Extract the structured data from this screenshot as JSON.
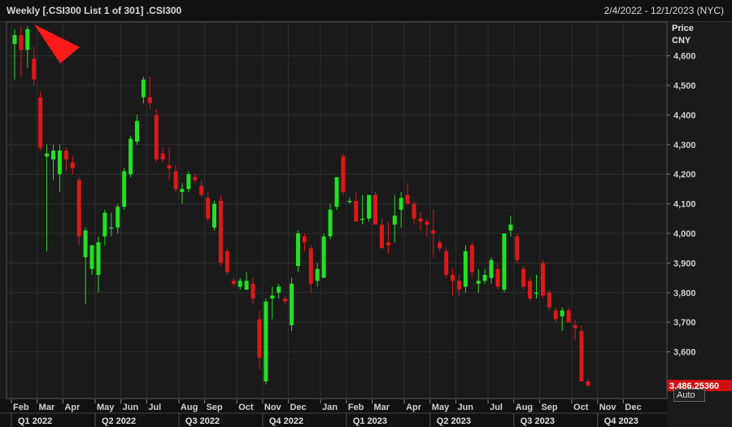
{
  "header": {
    "title": "Weekly [.CSI300 List 1 of 301] .CSI300",
    "date_range": "2/4/2022 - 12/1/2023 (NYC)"
  },
  "axis": {
    "price_label": "Price",
    "currency_label": "CNY",
    "auto_label": "Auto",
    "last_price": "3,486.25360"
  },
  "colors": {
    "up": "#22e022",
    "down": "#e01818",
    "background": "#1a1a1a",
    "grid": "#2e2e2e",
    "marker": "#ff1a1a"
  },
  "chart_data": {
    "type": "candlestick",
    "title": "Weekly [.CSI300 List 1 of 301] .CSI300",
    "ylabel": "Price CNY",
    "ylim": [
      3480,
      4760
    ],
    "yticks": [
      3600,
      3700,
      3800,
      3900,
      4000,
      4100,
      4200,
      4300,
      4400,
      4500,
      4600
    ],
    "ytick_labels": [
      "3,600",
      "3,700",
      "3,800",
      "3,900",
      "4,000",
      "4,100",
      "4,200",
      "4,300",
      "4,400",
      "4,500",
      "4,600"
    ],
    "grid": true,
    "months": [
      {
        "label": "Feb",
        "week": 0
      },
      {
        "label": "Mar",
        "week": 4
      },
      {
        "label": "Apr",
        "week": 8
      },
      {
        "label": "May",
        "week": 13
      },
      {
        "label": "Jun",
        "week": 17
      },
      {
        "label": "Jul",
        "week": 21
      },
      {
        "label": "Aug",
        "week": 26
      },
      {
        "label": "Sep",
        "week": 30
      },
      {
        "label": "Oct",
        "week": 35
      },
      {
        "label": "Nov",
        "week": 39
      },
      {
        "label": "Dec",
        "week": 43
      },
      {
        "label": "Jan",
        "week": 48
      },
      {
        "label": "Feb",
        "week": 52
      },
      {
        "label": "Mar",
        "week": 56
      },
      {
        "label": "Apr",
        "week": 61
      },
      {
        "label": "May",
        "week": 65
      },
      {
        "label": "Jun",
        "week": 69
      },
      {
        "label": "Jul",
        "week": 74
      },
      {
        "label": "Aug",
        "week": 78
      },
      {
        "label": "Sep",
        "week": 82
      },
      {
        "label": "Oct",
        "week": 87
      },
      {
        "label": "Nov",
        "week": 91
      },
      {
        "label": "Dec",
        "week": 95
      }
    ],
    "quarters": [
      {
        "label": "Q1 2022",
        "week": 0
      },
      {
        "label": "Q2 2022",
        "week": 13
      },
      {
        "label": "Q3 2022",
        "week": 26
      },
      {
        "label": "Q4 2022",
        "week": 39
      },
      {
        "label": "Q1 2023",
        "week": 52
      },
      {
        "label": "Q2 2023",
        "week": 65
      },
      {
        "label": "Q3 2023",
        "week": 78
      },
      {
        "label": "Q4 2023",
        "week": 91
      }
    ],
    "candles": [
      [
        4640,
        4690,
        4520,
        4670
      ],
      [
        4670,
        4700,
        4530,
        4620
      ],
      [
        4620,
        4700,
        4560,
        4690
      ],
      [
        4590,
        4630,
        4500,
        4520
      ],
      [
        4460,
        4480,
        4280,
        4290
      ],
      [
        4260,
        4300,
        3940,
        4270
      ],
      [
        4250,
        4300,
        4180,
        4280
      ],
      [
        4200,
        4300,
        4140,
        4280
      ],
      [
        4280,
        4290,
        4210,
        4250
      ],
      [
        4240,
        4260,
        4200,
        4220
      ],
      [
        4180,
        4190,
        3960,
        3990
      ],
      [
        3920,
        4020,
        3760,
        4010
      ],
      [
        3880,
        3960,
        3860,
        3960
      ],
      [
        3860,
        3990,
        3800,
        3970
      ],
      [
        3990,
        4080,
        3960,
        4070
      ],
      [
        4020,
        4070,
        3990,
        4020
      ],
      [
        4020,
        4100,
        4000,
        4090
      ],
      [
        4090,
        4220,
        4080,
        4210
      ],
      [
        4200,
        4330,
        4190,
        4320
      ],
      [
        4310,
        4400,
        4300,
        4380
      ],
      [
        4460,
        4530,
        4440,
        4520
      ],
      [
        4460,
        4530,
        4420,
        4440
      ],
      [
        4400,
        4420,
        4240,
        4250
      ],
      [
        4270,
        4290,
        4240,
        4250
      ],
      [
        4230,
        4290,
        4180,
        4220
      ],
      [
        4210,
        4230,
        4140,
        4150
      ],
      [
        4140,
        4170,
        4100,
        4150
      ],
      [
        4150,
        4210,
        4140,
        4200
      ],
      [
        4190,
        4200,
        4170,
        4180
      ],
      [
        4160,
        4180,
        4120,
        4130
      ],
      [
        4120,
        4140,
        4040,
        4050
      ],
      [
        4020,
        4110,
        4010,
        4100
      ],
      [
        4110,
        4130,
        3890,
        3900
      ],
      [
        3940,
        3950,
        3860,
        3870
      ],
      [
        3840,
        3850,
        3820,
        3830
      ],
      [
        3820,
        3850,
        3810,
        3840
      ],
      [
        3810,
        3870,
        3810,
        3840
      ],
      [
        3830,
        3850,
        3760,
        3780
      ],
      [
        3710,
        3740,
        3540,
        3580
      ],
      [
        3500,
        3780,
        3490,
        3770
      ],
      [
        3780,
        3820,
        3710,
        3790
      ],
      [
        3800,
        3830,
        3780,
        3820
      ],
      [
        3780,
        3790,
        3760,
        3770
      ],
      [
        3690,
        3850,
        3670,
        3830
      ],
      [
        3890,
        4010,
        3870,
        4000
      ],
      [
        3990,
        4000,
        3940,
        3970
      ],
      [
        3950,
        3960,
        3800,
        3830
      ],
      [
        3840,
        3900,
        3820,
        3880
      ],
      [
        3850,
        4000,
        3850,
        3990
      ],
      [
        3990,
        4100,
        3980,
        4080
      ],
      [
        4090,
        4190,
        4080,
        4190
      ],
      [
        4260,
        4270,
        4130,
        4140
      ],
      [
        4110,
        4120,
        4100,
        4110
      ],
      [
        4110,
        4140,
        4060,
        4040
      ],
      [
        4050,
        4130,
        4030,
        4050
      ],
      [
        4050,
        4130,
        4040,
        4130
      ],
      [
        4130,
        4140,
        4040,
        4030
      ],
      [
        4030,
        4050,
        3950,
        3950
      ],
      [
        3970,
        4040,
        3930,
        3960
      ],
      [
        4030,
        4130,
        3970,
        4060
      ],
      [
        4080,
        4140,
        4020,
        4120
      ],
      [
        4130,
        4170,
        4100,
        4100
      ],
      [
        4100,
        4110,
        4030,
        4050
      ],
      [
        4050,
        4070,
        4010,
        4040
      ],
      [
        4040,
        4050,
        3990,
        4030
      ],
      [
        4010,
        4080,
        3920,
        4000
      ],
      [
        3970,
        3980,
        3940,
        3950
      ],
      [
        3940,
        3950,
        3850,
        3860
      ],
      [
        3860,
        3880,
        3790,
        3840
      ],
      [
        3840,
        3860,
        3790,
        3810
      ],
      [
        3820,
        3960,
        3800,
        3940
      ],
      [
        3960,
        3970,
        3850,
        3870
      ],
      [
        3830,
        3880,
        3800,
        3840
      ],
      [
        3840,
        3880,
        3830,
        3860
      ],
      [
        3850,
        3920,
        3830,
        3910
      ],
      [
        3880,
        3900,
        3810,
        3820
      ],
      [
        3810,
        3950,
        3800,
        4000
      ],
      [
        4010,
        4060,
        3990,
        4030
      ],
      [
        3990,
        4000,
        3900,
        3910
      ],
      [
        3880,
        3890,
        3810,
        3820
      ],
      [
        3840,
        3850,
        3770,
        3780
      ],
      [
        3800,
        3860,
        3780,
        3800
      ],
      [
        3900,
        3910,
        3780,
        3790
      ],
      [
        3800,
        3810,
        3740,
        3750
      ],
      [
        3740,
        3750,
        3700,
        3710
      ],
      [
        3720,
        3750,
        3670,
        3740
      ],
      [
        3740,
        3750,
        3700,
        3700
      ],
      [
        3690,
        3710,
        3640,
        3680
      ],
      [
        3670,
        3690,
        3500,
        3500
      ],
      [
        3500,
        3510,
        3480,
        3486.25
      ]
    ]
  }
}
